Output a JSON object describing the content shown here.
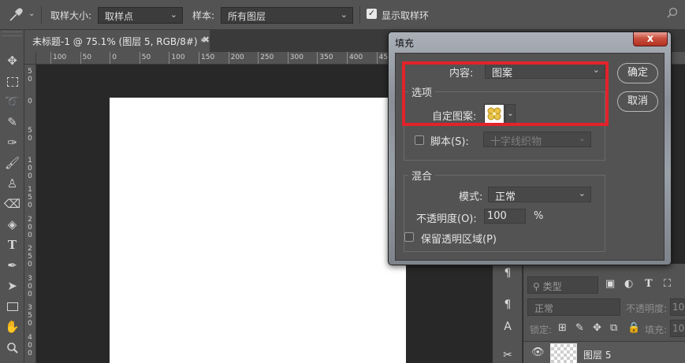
{
  "options_bar": {
    "tool_icon": "eyedropper-icon",
    "sample_size_label": "取样大小:",
    "sample_size_value": "取样点",
    "sample_label": "样本:",
    "sample_value": "所有图层",
    "show_ring_label": "显示取样环",
    "show_ring_checked": true
  },
  "toolbar": {
    "tools": [
      "move-icon",
      "marquee-icon",
      "lasso-icon",
      "quick-select-icon",
      "eyedropper-icon",
      "brush-icon",
      "stamp-icon",
      "eraser-icon",
      "paint-bucket-icon",
      "type-icon",
      "pen-icon",
      "path-select-icon",
      "rectangle-icon",
      "hand-icon",
      "zoom-icon"
    ]
  },
  "document": {
    "tab_title": "未标题-1 @ 75.1% (图层 5, RGB/8#) *",
    "ruler_top": [
      "100",
      "50",
      "0",
      "50",
      "100",
      "150",
      "200",
      "250",
      "300",
      "350",
      "400",
      "450"
    ],
    "ruler_left": [
      "5\n0",
      "0",
      "5\n0",
      "1\n0\n0",
      "1\n5\n0",
      "2\n0\n0",
      "2\n5\n0",
      "3\n0\n0",
      "3\n5\n0",
      "4\n0\n0"
    ]
  },
  "layers_panel": {
    "filter_label": "类型",
    "blend_mode": "正常",
    "opacity_label": "不透明度:",
    "opacity_value": "10",
    "lock_label": "锁定:",
    "fill_label": "填充:",
    "fill_value": "10",
    "layer_name": "图层 5"
  },
  "fill_dialog": {
    "title": "填充",
    "close_label": "x",
    "contents_label": "内容:",
    "contents_value": "图案",
    "options_group": "选项",
    "custom_pattern_label": "自定图案:",
    "script_label": "脚本(S):",
    "script_value": "十字线织物",
    "script_checked": false,
    "blending_group": "混合",
    "mode_label": "模式:",
    "mode_value": "正常",
    "opacity_label": "不透明度(O):",
    "opacity_value": "100",
    "opacity_unit": "%",
    "preserve_label": "保留透明区域(P)",
    "preserve_checked": false,
    "ok_button": "确定",
    "cancel_button": "取消",
    "highlight_color": "#e2232a"
  }
}
